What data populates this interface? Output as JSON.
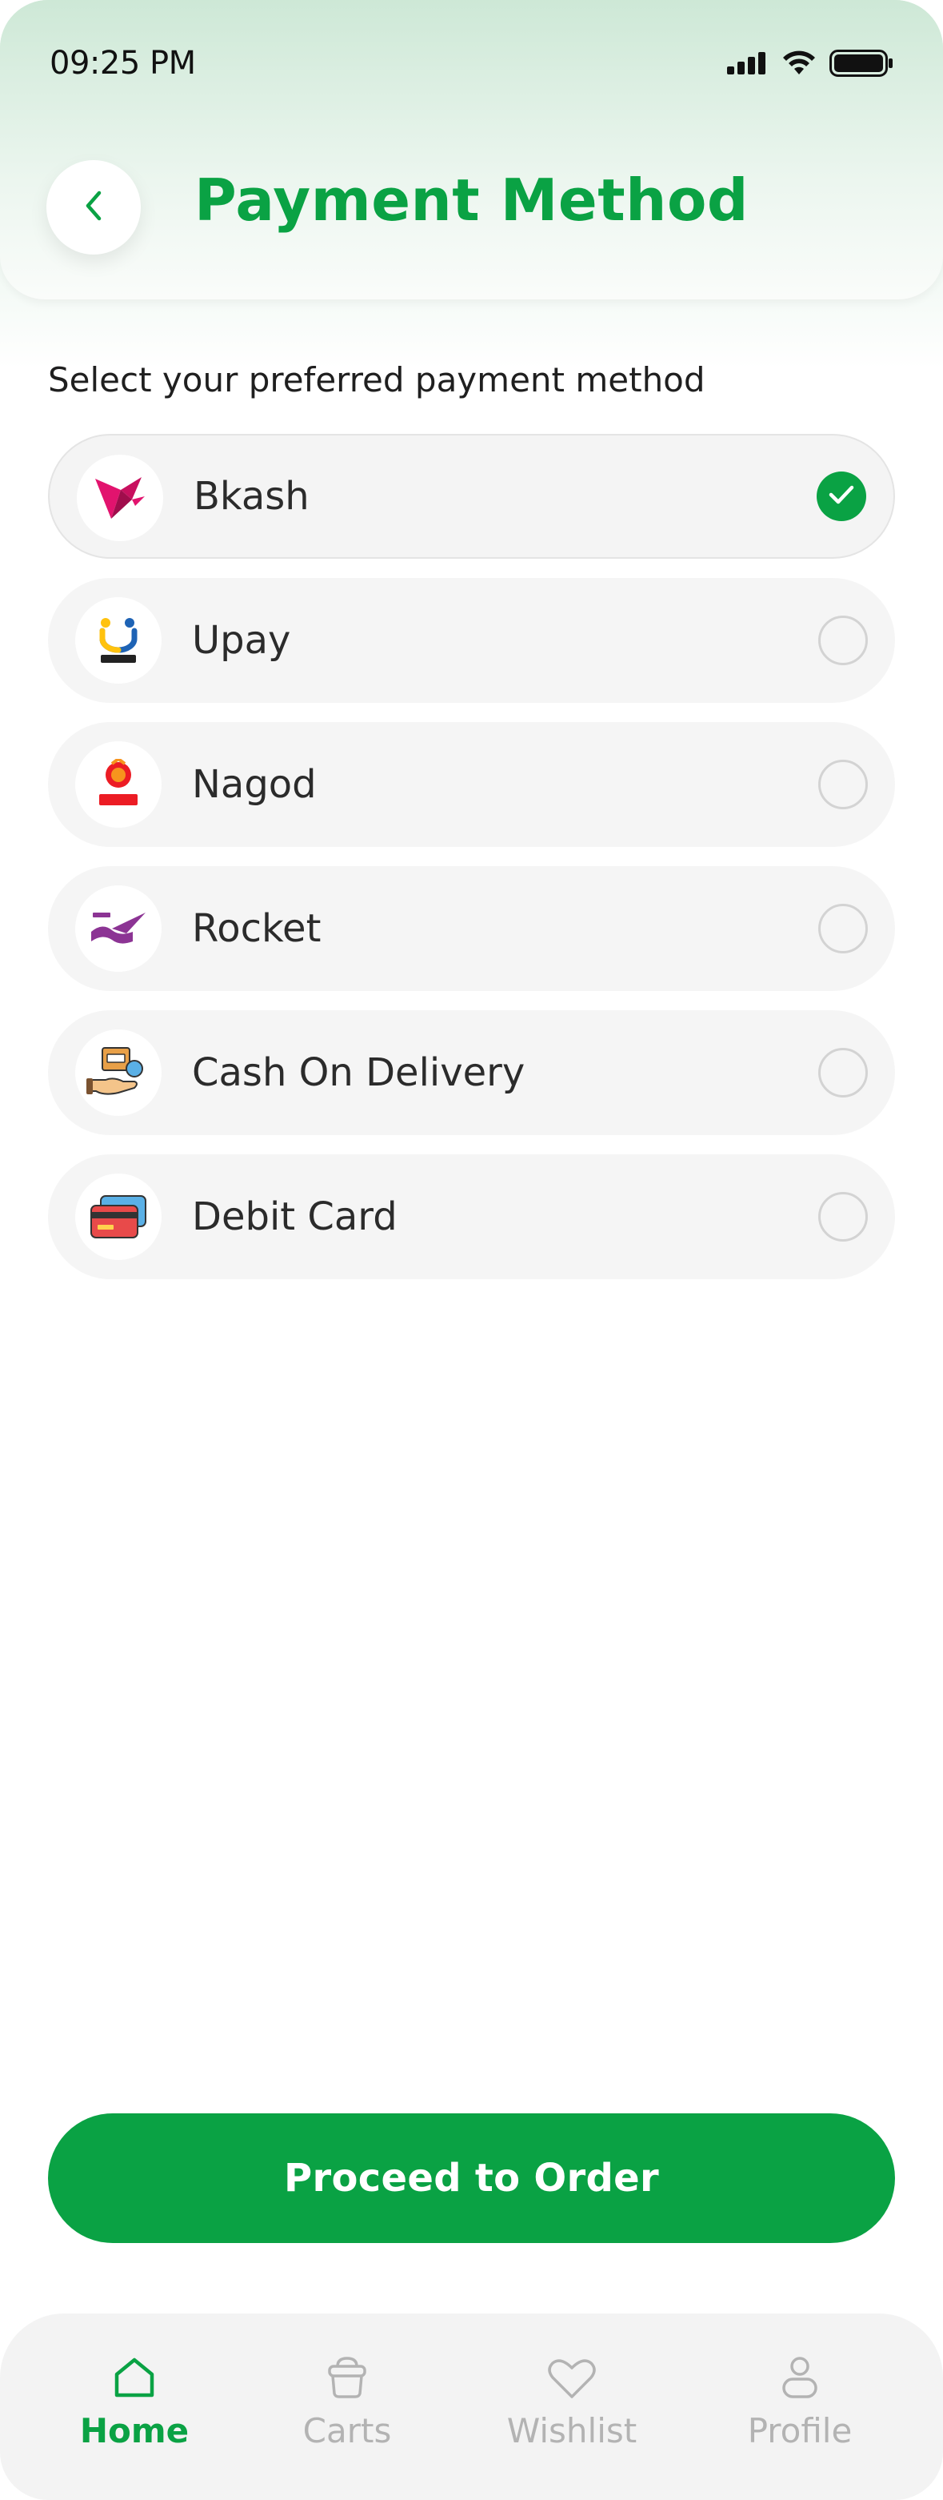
{
  "status_bar": {
    "time": "09:25 PM"
  },
  "header": {
    "title": "Payment Method"
  },
  "subtitle": "Select your preferred payment method",
  "methods": [
    {
      "label": "Bkash",
      "icon": "bkash-logo-icon",
      "selected": true
    },
    {
      "label": "Upay",
      "icon": "upay-logo-icon",
      "selected": false
    },
    {
      "label": "Nagod",
      "icon": "nagad-logo-icon",
      "selected": false
    },
    {
      "label": "Rocket",
      "icon": "rocket-logo-icon",
      "selected": false
    },
    {
      "label": "Cash On Delivery",
      "icon": "cash-on-delivery-icon",
      "selected": false
    },
    {
      "label": "Debit Card",
      "icon": "debit-card-icon",
      "selected": false
    }
  ],
  "proceed_label": "Proceed to Order",
  "nav": {
    "items": [
      {
        "label": "Home",
        "icon": "home-icon",
        "active": true
      },
      {
        "label": "Carts",
        "icon": "cart-icon",
        "active": false
      },
      {
        "label": "Wishlist",
        "icon": "heart-icon",
        "active": false
      },
      {
        "label": "Profile",
        "icon": "user-icon",
        "active": false
      }
    ]
  },
  "colors": {
    "accent": "#0aa244",
    "inactive": "#b3b3b3",
    "card_bg": "#f5f5f5",
    "radio_border": "#d3d3d3"
  }
}
